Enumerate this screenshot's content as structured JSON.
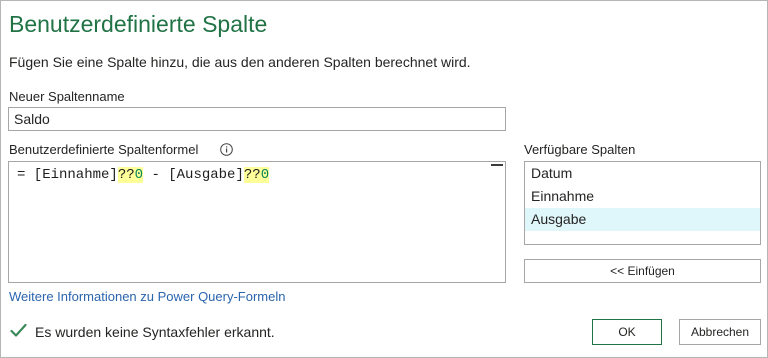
{
  "dialog": {
    "title": "Benutzerdefinierte Spalte",
    "subtitle": "Fügen Sie eine Spalte hinzu, die aus den anderen Spalten berechnet wird."
  },
  "name_field": {
    "label": "Neuer Spaltenname",
    "value": "Saldo"
  },
  "formula": {
    "label": "Benutzerdefinierte Spaltenformel",
    "info_icon": "info-icon",
    "parts": {
      "prefix": "= [Einnahme]",
      "op1": "??",
      "num1": "0",
      "middle": " - [Ausgabe]",
      "op2": "??",
      "num2": "0"
    }
  },
  "columns": {
    "label": "Verfügbare Spalten",
    "items": [
      "Datum",
      "Einnahme",
      "Ausgabe"
    ],
    "selected": "Ausgabe",
    "insert_label": "<< Einfügen"
  },
  "help_link": "Weitere Informationen zu Power Query-Formeln",
  "status": {
    "icon": "checkmark-icon",
    "text": "Es wurden keine Syntaxfehler erkannt."
  },
  "buttons": {
    "ok": "OK",
    "cancel": "Abbrechen"
  },
  "colors": {
    "title": "#217346",
    "link": "#2b65ae",
    "selected_bg": "#dff6fb",
    "highlight": "#ffff99"
  }
}
